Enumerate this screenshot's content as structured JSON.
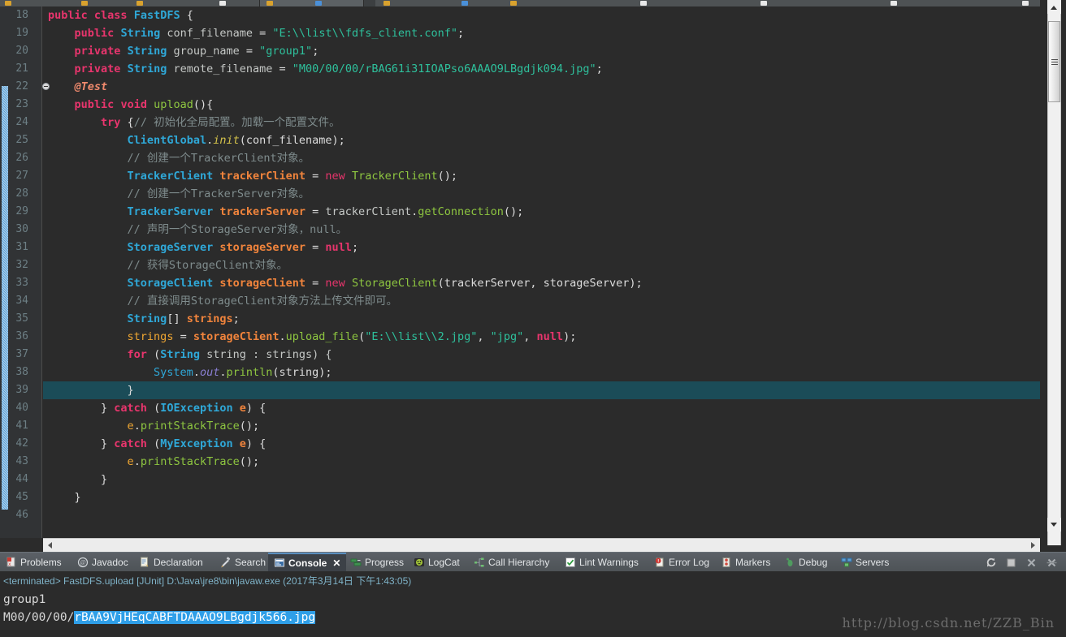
{
  "window": {
    "theme_bg": "#2b2b2b",
    "accent": "#2f9fe8",
    "highlight_line_bg": "#1b4c58"
  },
  "editor": {
    "first_line": 18,
    "last_line": 46,
    "highlighted_line": 39,
    "folded_marker_line": 22,
    "line_numbers": [
      "18",
      "19",
      "20",
      "21",
      "22",
      "23",
      "24",
      "25",
      "26",
      "27",
      "28",
      "29",
      "30",
      "31",
      "32",
      "33",
      "34",
      "35",
      "36",
      "37",
      "38",
      "39",
      "40",
      "41",
      "42",
      "43",
      "44",
      "45",
      "46"
    ],
    "lines": [
      {
        "n": "18",
        "text": "public class FastDFS {"
      },
      {
        "n": "19",
        "text": "    public String conf_filename = \"E:\\\\list\\\\fdfs_client.conf\";"
      },
      {
        "n": "20",
        "text": "    private String group_name = \"group1\";"
      },
      {
        "n": "21",
        "text": "    private String remote_filename = \"M00/00/00/rBAG61i31IOAPso6AAAO9LBgdjk094.jpg\";"
      },
      {
        "n": "22",
        "text": "    @Test"
      },
      {
        "n": "23",
        "text": "    public void upload(){"
      },
      {
        "n": "24",
        "text": "        try {// 初始化全局配置。加载一个配置文件。"
      },
      {
        "n": "25",
        "text": "            ClientGlobal.init(conf_filename);"
      },
      {
        "n": "26",
        "text": "            // 创建一个TrackerClient对象。"
      },
      {
        "n": "27",
        "text": "            TrackerClient trackerClient = new TrackerClient();"
      },
      {
        "n": "28",
        "text": "            // 创建一个TrackerServer对象。"
      },
      {
        "n": "29",
        "text": "            TrackerServer trackerServer = trackerClient.getConnection();"
      },
      {
        "n": "30",
        "text": "            // 声明一个StorageServer对象，null。"
      },
      {
        "n": "31",
        "text": "            StorageServer storageServer = null;"
      },
      {
        "n": "32",
        "text": "            // 获得StorageClient对象。"
      },
      {
        "n": "33",
        "text": "            StorageClient storageClient = new StorageClient(trackerServer, storageServer);"
      },
      {
        "n": "34",
        "text": "            // 直接调用StorageClient对象方法上传文件即可。"
      },
      {
        "n": "35",
        "text": "            String[] strings;"
      },
      {
        "n": "36",
        "text": "            strings = storageClient.upload_file(\"E:\\\\list\\\\2.jpg\", \"jpg\", null);"
      },
      {
        "n": "37",
        "text": "            for (String string : strings) {"
      },
      {
        "n": "38",
        "text": "                System.out.println(string);"
      },
      {
        "n": "39",
        "text": "            }"
      },
      {
        "n": "40",
        "text": "        } catch (IOException e) {"
      },
      {
        "n": "41",
        "text": "            e.printStackTrace();"
      },
      {
        "n": "42",
        "text": "        } catch (MyException e) {"
      },
      {
        "n": "43",
        "text": "            e.printStackTrace();"
      },
      {
        "n": "44",
        "text": "        }"
      },
      {
        "n": "45",
        "text": "    }"
      },
      {
        "n": "46",
        "text": ""
      }
    ],
    "tokens": {
      "line18": {
        "kw1": "public",
        "kw2": "class",
        "cls": "FastDFS",
        "brace": " {"
      },
      "line19": {
        "mod": "public",
        "type": "String",
        "name": "conf_filename",
        "eq": " = ",
        "str": "\"E:\\\\list\\\\fdfs_client.conf\"",
        "semi": ";"
      },
      "line20": {
        "mod": "private",
        "type": "String",
        "name": "group_name",
        "eq": " = ",
        "str": "\"group1\"",
        "semi": ";"
      },
      "line21": {
        "mod": "private",
        "type": "String",
        "name": "remote_filename",
        "eq": " = ",
        "str": "\"M00/00/00/rBAG61i31IOAPso6AAAO9LBgdjk094.jpg\"",
        "semi": ";"
      },
      "line22": {
        "annotation": "@Test"
      },
      "line23": {
        "mod": "public",
        "type": "void",
        "name": "upload",
        "rest": "(){"
      },
      "line24": {
        "kw": "try",
        "brace": " {",
        "comment": "// 初始化全局配置。加载一个配置文件。"
      },
      "line25": {
        "cls": "ClientGlobal",
        "dot": ".",
        "mth": "init",
        "rest": "(conf_filename);"
      },
      "line26": {
        "comment": "// 创建一个TrackerClient对象。"
      },
      "line27": {
        "type": "TrackerClient",
        "name": "trackerClient",
        "eq": " = ",
        "newkw": "new",
        "ctor": "TrackerClient",
        "rest": "();"
      },
      "line28": {
        "comment": "// 创建一个TrackerServer对象。"
      },
      "line29": {
        "type": "TrackerServer",
        "name": "trackerServer",
        "eq": " = ",
        "obj": "trackerClient",
        "dot": ".",
        "mth": "getConnection",
        "rest": "();"
      },
      "line30": {
        "comment": "// 声明一个StorageServer对象，null。"
      },
      "line31": {
        "type": "StorageServer",
        "name": "storageServer",
        "eq": " = ",
        "nul": "null",
        "semi": ";"
      },
      "line32": {
        "comment": "// 获得StorageClient对象。"
      },
      "line33": {
        "type": "StorageClient",
        "name": "storageClient",
        "eq": " = ",
        "newkw": "new",
        "ctor": "StorageClient",
        "args": "(trackerServer, storageServer);"
      },
      "line34": {
        "comment": "// 直接调用StorageClient对象方法上传文件即可。"
      },
      "line35": {
        "type": "String",
        "brackets": "[] ",
        "name": "strings",
        "semi": ";"
      },
      "line36": {
        "name": "strings",
        "eq": " = ",
        "obj": "storageClient",
        "dot": ".",
        "mth": "upload_file",
        "p1": "(",
        "s1": "\"E:\\\\list\\\\2.jpg\"",
        "c1": ", ",
        "s2": "\"jpg\"",
        "c2": ", ",
        "nul": "null",
        "rest": ");"
      },
      "line37": {
        "kw": "for",
        "p": " (",
        "type": "String",
        "v": " string : strings) {"
      },
      "line38": {
        "cls": "System",
        "dot1": ".",
        "fld": "out",
        "dot2": ".",
        "mth": "println",
        "rest": "(string);"
      },
      "line39": {
        "brace": "}"
      },
      "line40": {
        "close": "} ",
        "kw": "catch",
        "p": " (",
        "type": "IOException",
        "v": " e",
        "rest": ") {"
      },
      "line41": {
        "obj": "e",
        "dot": ".",
        "mth": "printStackTrace",
        "rest": "();"
      },
      "line42": {
        "close": "} ",
        "kw": "catch",
        "p": " (",
        "type": "MyException",
        "v": " e",
        "rest": ") {"
      },
      "line43": {
        "obj": "e",
        "dot": ".",
        "mth": "printStackTrace",
        "rest": "();"
      },
      "line44": {
        "brace": "}"
      },
      "line45": {
        "brace": "}"
      }
    }
  },
  "view_tabs": [
    {
      "id": "problems",
      "label": "Problems",
      "icon": "problems-icon",
      "active": false
    },
    {
      "id": "javadoc",
      "label": "Javadoc",
      "icon": "javadoc-icon",
      "active": false
    },
    {
      "id": "declaration",
      "label": "Declaration",
      "icon": "declaration-icon",
      "active": false
    },
    {
      "id": "search",
      "label": "Search",
      "icon": "search-icon",
      "active": false
    },
    {
      "id": "console",
      "label": "Console",
      "icon": "console-icon",
      "active": true
    },
    {
      "id": "progress",
      "label": "Progress",
      "icon": "progress-icon",
      "active": false
    },
    {
      "id": "logcat",
      "label": "LogCat",
      "icon": "logcat-icon",
      "active": false
    },
    {
      "id": "call-hierarchy",
      "label": "Call Hierarchy",
      "icon": "call-hierarchy-icon",
      "active": false
    },
    {
      "id": "lint-warnings",
      "label": "Lint Warnings",
      "icon": "lint-warnings-icon",
      "active": false
    },
    {
      "id": "error-log",
      "label": "Error Log",
      "icon": "error-log-icon",
      "active": false
    },
    {
      "id": "markers",
      "label": "Markers",
      "icon": "markers-icon",
      "active": false
    },
    {
      "id": "debug",
      "label": "Debug",
      "icon": "debug-icon",
      "active": false
    },
    {
      "id": "servers",
      "label": "Servers",
      "icon": "servers-icon",
      "active": false
    }
  ],
  "view_tab_close_glyph": "✕",
  "view_toolbar": [
    {
      "id": "relaunch",
      "icon": "relaunch-icon"
    },
    {
      "id": "terminate",
      "icon": "stop-square-icon"
    },
    {
      "id": "remove",
      "icon": "close-x-icon"
    },
    {
      "id": "remove-all",
      "icon": "remove-all-terminated-icon"
    }
  ],
  "console": {
    "status": "<terminated> FastDFS.upload [JUnit] D:\\Java\\jre8\\bin\\javaw.exe (2017年3月14日 下午1:43:05)",
    "output_line_1": "group1",
    "output_line_2_prefix": "M00/00/00/",
    "output_line_2_selected": "rBAA9VjHEqCABFTDAAAO9LBgdjk566.jpg"
  },
  "watermark": "http://blog.csdn.net/ZZB_Bin"
}
